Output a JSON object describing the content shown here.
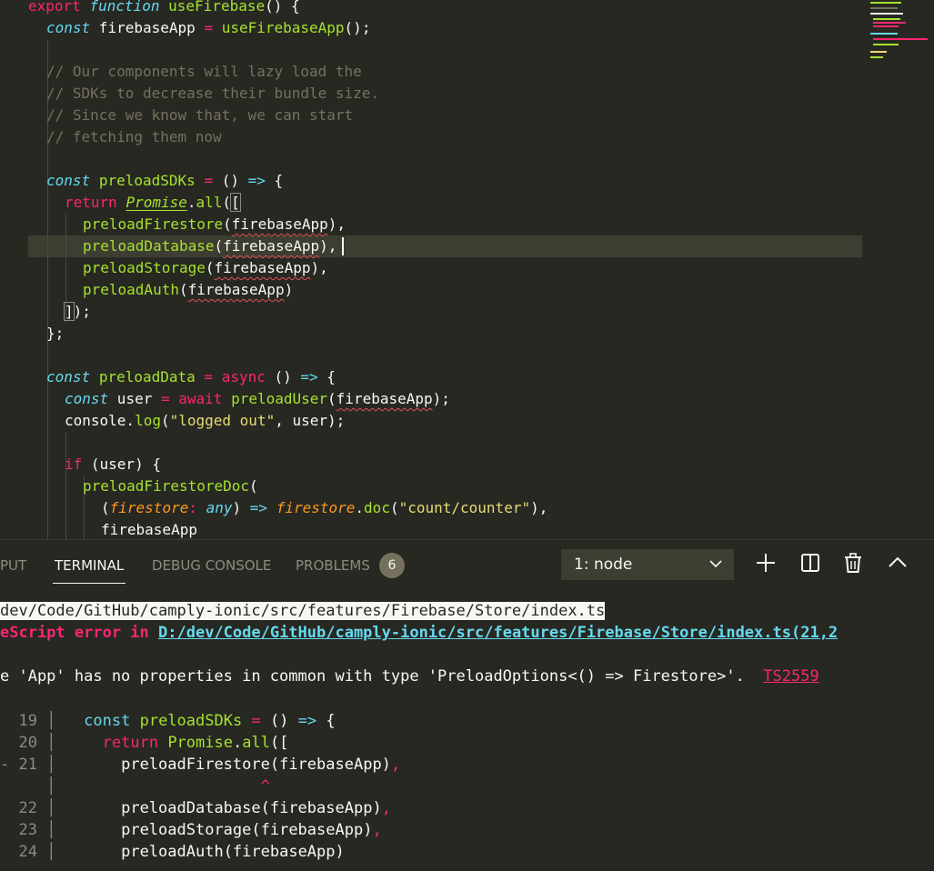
{
  "editor": {
    "code_lines": [
      "export function useFirebase() {",
      "const firebaseApp = useFirebaseApp();",
      "// Our components will lazy load the",
      "// SDKs to decrease their bundle size.",
      "// Since we know that, we can start",
      "// fetching them now",
      "const preloadSDKs = () => {",
      "return Promise.all([",
      "preloadFirestore(firebaseApp),",
      "preloadDatabase(firebaseApp),",
      "preloadStorage(firebaseApp),",
      "preloadAuth(firebaseApp)",
      "]);",
      "};",
      "const preloadData = async () => {",
      "const user = await preloadUser(firebaseApp);",
      "console.log(\"logged out\", user);",
      "if (user) {",
      "preloadFirestoreDoc(",
      "(firestore: any) => firestore.doc(\"count/counter\"),",
      "firebaseApp"
    ]
  },
  "panel": {
    "tabs": [
      {
        "label": "PUT",
        "active": false
      },
      {
        "label": "TERMINAL",
        "active": true
      },
      {
        "label": "DEBUG CONSOLE",
        "active": false
      },
      {
        "label": "PROBLEMS",
        "active": false
      }
    ],
    "problems_count": "6",
    "terminal_select": "1: node",
    "icons": [
      "add-icon",
      "split-icon",
      "trash-icon",
      "chevron-up-icon"
    ]
  },
  "terminal": {
    "path_line": "dev/Code/GitHub/camply-ionic/src/features/Firebase/Store/index.ts",
    "error_prefix": "eScript error in",
    "error_link": "D:/dev/Code/GitHub/camply-ionic/src/features/Firebase/Store/index.ts(21,2",
    "message": "e 'App' has no properties in common with type 'PreloadOptions<() => Firestore>'.",
    "error_code": "TS2559",
    "snippet": [
      {
        "gutter": "19",
        "code": "const preloadSDKs = () => {"
      },
      {
        "gutter": "20",
        "code": "return Promise.all(["
      },
      {
        "gutter": "21",
        "code": "preloadFirestore(firebaseApp),"
      },
      {
        "gutter": "",
        "code": "^"
      },
      {
        "gutter": "22",
        "code": "preloadDatabase(firebaseApp),"
      },
      {
        "gutter": "23",
        "code": "preloadStorage(firebaseApp),"
      },
      {
        "gutter": "24",
        "code": "preloadAuth(firebaseApp)"
      }
    ]
  },
  "colors": {
    "background": "#272822",
    "keyword": "#f92672",
    "function": "#a6e22e",
    "storage": "#66d9ef",
    "string": "#e6db74",
    "comment": "#75715e"
  }
}
